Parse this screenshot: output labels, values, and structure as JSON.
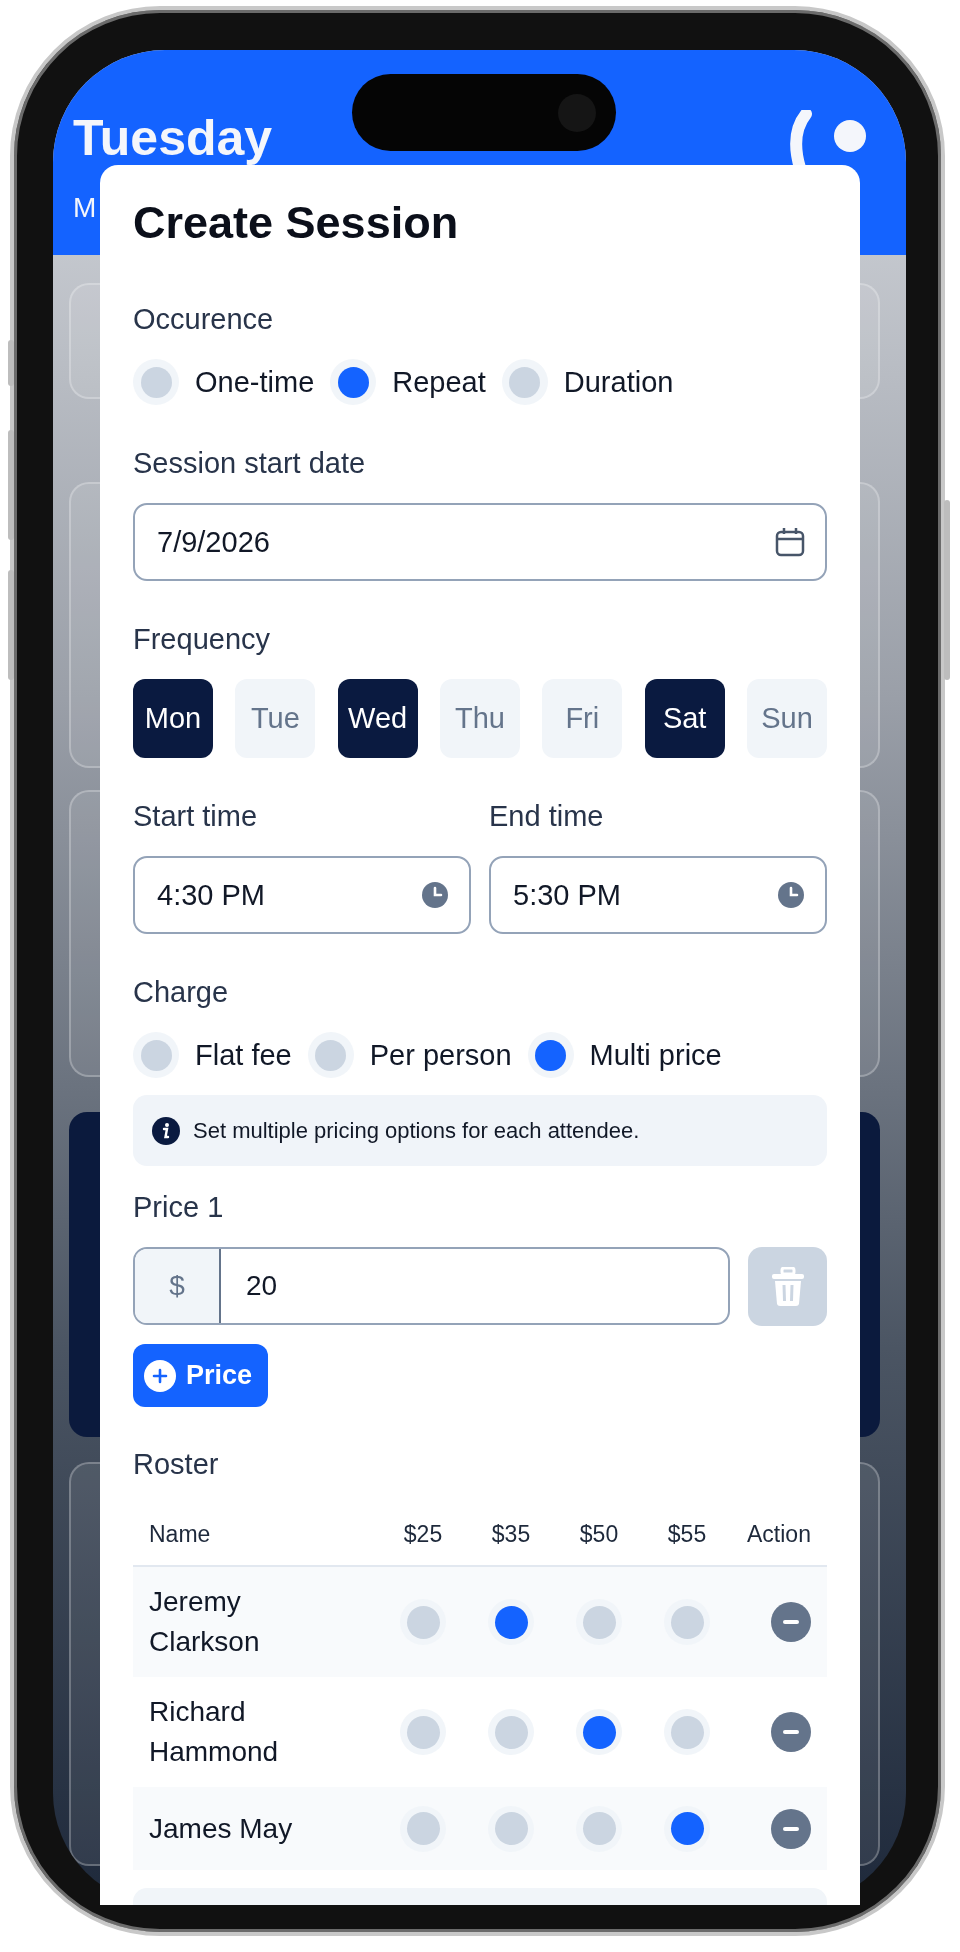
{
  "background": {
    "header_title": "Tuesday",
    "header_subtitle": "M"
  },
  "modal": {
    "title": "Create Session",
    "occurrence": {
      "label": "Occurence",
      "options": [
        {
          "label": "One-time",
          "selected": false
        },
        {
          "label": "Repeat",
          "selected": true
        },
        {
          "label": "Duration",
          "selected": false
        }
      ]
    },
    "start_date": {
      "label": "Session start date",
      "value": "7/9/2026"
    },
    "frequency": {
      "label": "Frequency",
      "days": [
        {
          "label": "Mon",
          "selected": true
        },
        {
          "label": "Tue",
          "selected": false
        },
        {
          "label": "Wed",
          "selected": true
        },
        {
          "label": "Thu",
          "selected": false
        },
        {
          "label": "Fri",
          "selected": false
        },
        {
          "label": "Sat",
          "selected": true
        },
        {
          "label": "Sun",
          "selected": false
        }
      ]
    },
    "start_time": {
      "label": "Start time",
      "value": "4:30 PM"
    },
    "end_time": {
      "label": "End time",
      "value": "5:30 PM"
    },
    "charge": {
      "label": "Charge",
      "options": [
        {
          "label": "Flat fee",
          "selected": false
        },
        {
          "label": "Per person",
          "selected": false
        },
        {
          "label": "Multi price",
          "selected": true
        }
      ],
      "info": "Set multiple pricing options for each attendee."
    },
    "prices": [
      {
        "label": "Price 1",
        "currency": "$",
        "value": "20"
      }
    ],
    "add_price_button": "Price",
    "roster": {
      "label": "Roster",
      "columns": [
        "Name",
        "$25",
        "$35",
        "$50",
        "$55",
        "Action"
      ],
      "rows": [
        {
          "name": "Jeremy Clarkson",
          "choices": [
            {
              "selected": false
            },
            {
              "selected": true
            },
            {
              "selected": false
            },
            {
              "selected": false
            }
          ]
        },
        {
          "name": "Richard Hammond",
          "choices": [
            {
              "selected": false
            },
            {
              "selected": false
            },
            {
              "selected": true
            },
            {
              "selected": false
            }
          ]
        },
        {
          "name": "James May",
          "choices": [
            {
              "selected": false
            },
            {
              "selected": false
            },
            {
              "selected": false
            },
            {
              "selected": true
            }
          ]
        }
      ]
    }
  }
}
